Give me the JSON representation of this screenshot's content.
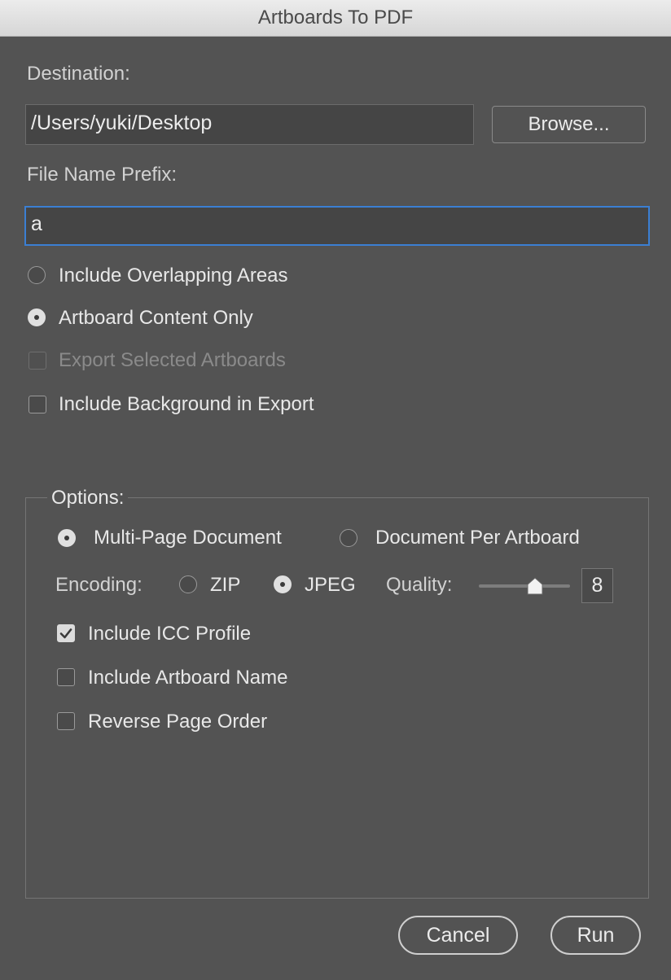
{
  "window": {
    "title": "Artboards To PDF"
  },
  "destination": {
    "label": "Destination:",
    "path": "/Users/yuki/Desktop",
    "browse_label": "Browse..."
  },
  "prefix": {
    "label": "File Name Prefix:",
    "value": "a"
  },
  "export_area": {
    "include_overlapping": {
      "label": "Include Overlapping Areas",
      "selected": false
    },
    "artboard_content_only": {
      "label": "Artboard Content Only",
      "selected": true
    }
  },
  "export_selected": {
    "label": "Export Selected Artboards",
    "checked": false,
    "enabled": false
  },
  "include_background": {
    "label": "Include Background in Export",
    "checked": false
  },
  "options": {
    "legend": "Options:",
    "multi_page": {
      "label": "Multi-Page Document",
      "selected": true
    },
    "per_artboard": {
      "label": "Document Per Artboard",
      "selected": false
    },
    "encoding": {
      "label": "Encoding:",
      "zip": {
        "label": "ZIP",
        "selected": false
      },
      "jpeg": {
        "label": "JPEG",
        "selected": true
      }
    },
    "quality": {
      "label": "Quality:",
      "value": "8",
      "slider_fraction": 0.62
    },
    "icc_profile": {
      "label": "Include ICC Profile",
      "checked": true
    },
    "artboard_name": {
      "label": "Include Artboard Name",
      "checked": false
    },
    "reverse_order": {
      "label": "Reverse Page Order",
      "checked": false
    }
  },
  "buttons": {
    "cancel": "Cancel",
    "run": "Run"
  }
}
